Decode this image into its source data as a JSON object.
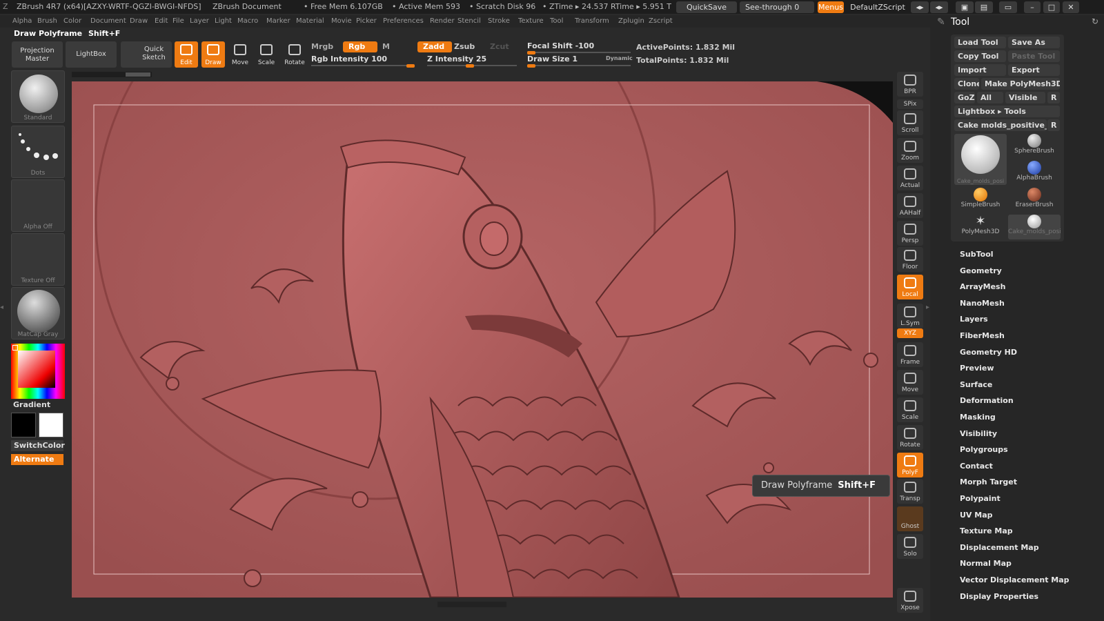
{
  "titlebar": {
    "app_title": "ZBrush 4R7 (x64)[AZXY-WRTF-QGZI-BWGI-NFDS]",
    "doc_title": "ZBrush Document",
    "free_mem": "• Free Mem 6.107GB",
    "active_mem": "• Active Mem 593",
    "scratch": "• Scratch Disk 96",
    "ztime": "• ZTime ▸ 24.537  RTime ▸ 5.951  T",
    "quicksave": "QuickSave",
    "seethrough": "See-through  0",
    "menus": "Menus",
    "script": "DefaultZScript"
  },
  "menubar": [
    "Alpha",
    "Brush",
    "Color",
    "Document",
    "Draw",
    "Edit",
    "File",
    "Layer",
    "Light",
    "Macro",
    "Marker",
    "Material",
    "Movie",
    "Picker",
    "Preferences",
    "Render",
    "Stencil",
    "Stroke",
    "Texture",
    "Tool",
    "Transform",
    "Zplugin",
    "Zscript"
  ],
  "info": {
    "label": "Draw Polyframe",
    "shortcut": "Shift+F"
  },
  "toolbar": {
    "projection_master": "Projection Master",
    "lightbox": "LightBox",
    "quick_sketch": "Quick Sketch",
    "edit": "Edit",
    "draw": "Draw",
    "move": "Move",
    "scale": "Scale",
    "rotate": "Rotate",
    "mrgb": "Mrgb",
    "rgb": "Rgb",
    "m": "M",
    "rgb_intensity": "Rgb Intensity 100",
    "zadd": "Zadd",
    "zsub": "Zsub",
    "zcut": "Zcut",
    "z_intensity": "Z Intensity 25",
    "focal_shift": "Focal Shift -100",
    "draw_size": "Draw Size 1",
    "dynamic": "Dynamic",
    "active_points": "ActivePoints: 1.832  Mil",
    "total_points": "TotalPoints: 1.832  Mil"
  },
  "leftshelf": {
    "standard": "Standard",
    "dots": "Dots",
    "alpha": "Alpha Off",
    "texture": "Texture Off",
    "matcap": "MatCap Gray",
    "gradient": "Gradient",
    "switchcolor": "SwitchColor",
    "alternate": "Alternate"
  },
  "rightshelf": [
    "BPR",
    "SPix",
    "Scroll",
    "Zoom",
    "Actual",
    "AAHalf",
    "Persp",
    "Floor",
    "Local",
    "L.Sym",
    "XYZ",
    "Frame",
    "Move",
    "Scale",
    "Rotate",
    "PolyF",
    "Transp",
    "Ghost",
    "Solo",
    "Xpose"
  ],
  "panel": {
    "title": "Tool",
    "load_tool": "Load Tool",
    "save_as": "Save As",
    "copy_tool": "Copy Tool",
    "paste_tool": "Paste Tool",
    "import": "Import",
    "export": "Export",
    "clone": "Clone",
    "make_polymesh": "Make PolyMesh3D",
    "goz": "GoZ",
    "all": "All",
    "visible": "Visible",
    "r": "R",
    "lightbox_tools": "Lightbox ▸ Tools",
    "current_tool": "Cake molds_positive_C",
    "thumbs": [
      "Cake_molds_posi",
      "SphereBrush",
      "AlphaBrush",
      "SimpleBrush",
      "EraserBrush",
      "PolyMesh3D",
      "Cake_molds_posi"
    ],
    "sections": [
      "SubTool",
      "Geometry",
      "ArrayMesh",
      "NanoMesh",
      "Layers",
      "FiberMesh",
      "Geometry HD",
      "Preview",
      "Surface",
      "Deformation",
      "Masking",
      "Visibility",
      "Polygroups",
      "Contact",
      "Morph Target",
      "Polypaint",
      "UV Map",
      "Texture Map",
      "Displacement Map",
      "Normal Map",
      "Vector Displacement Map",
      "Display Properties"
    ]
  },
  "tooltip": {
    "label": "Draw Polyframe",
    "shortcut": "Shift+F"
  }
}
